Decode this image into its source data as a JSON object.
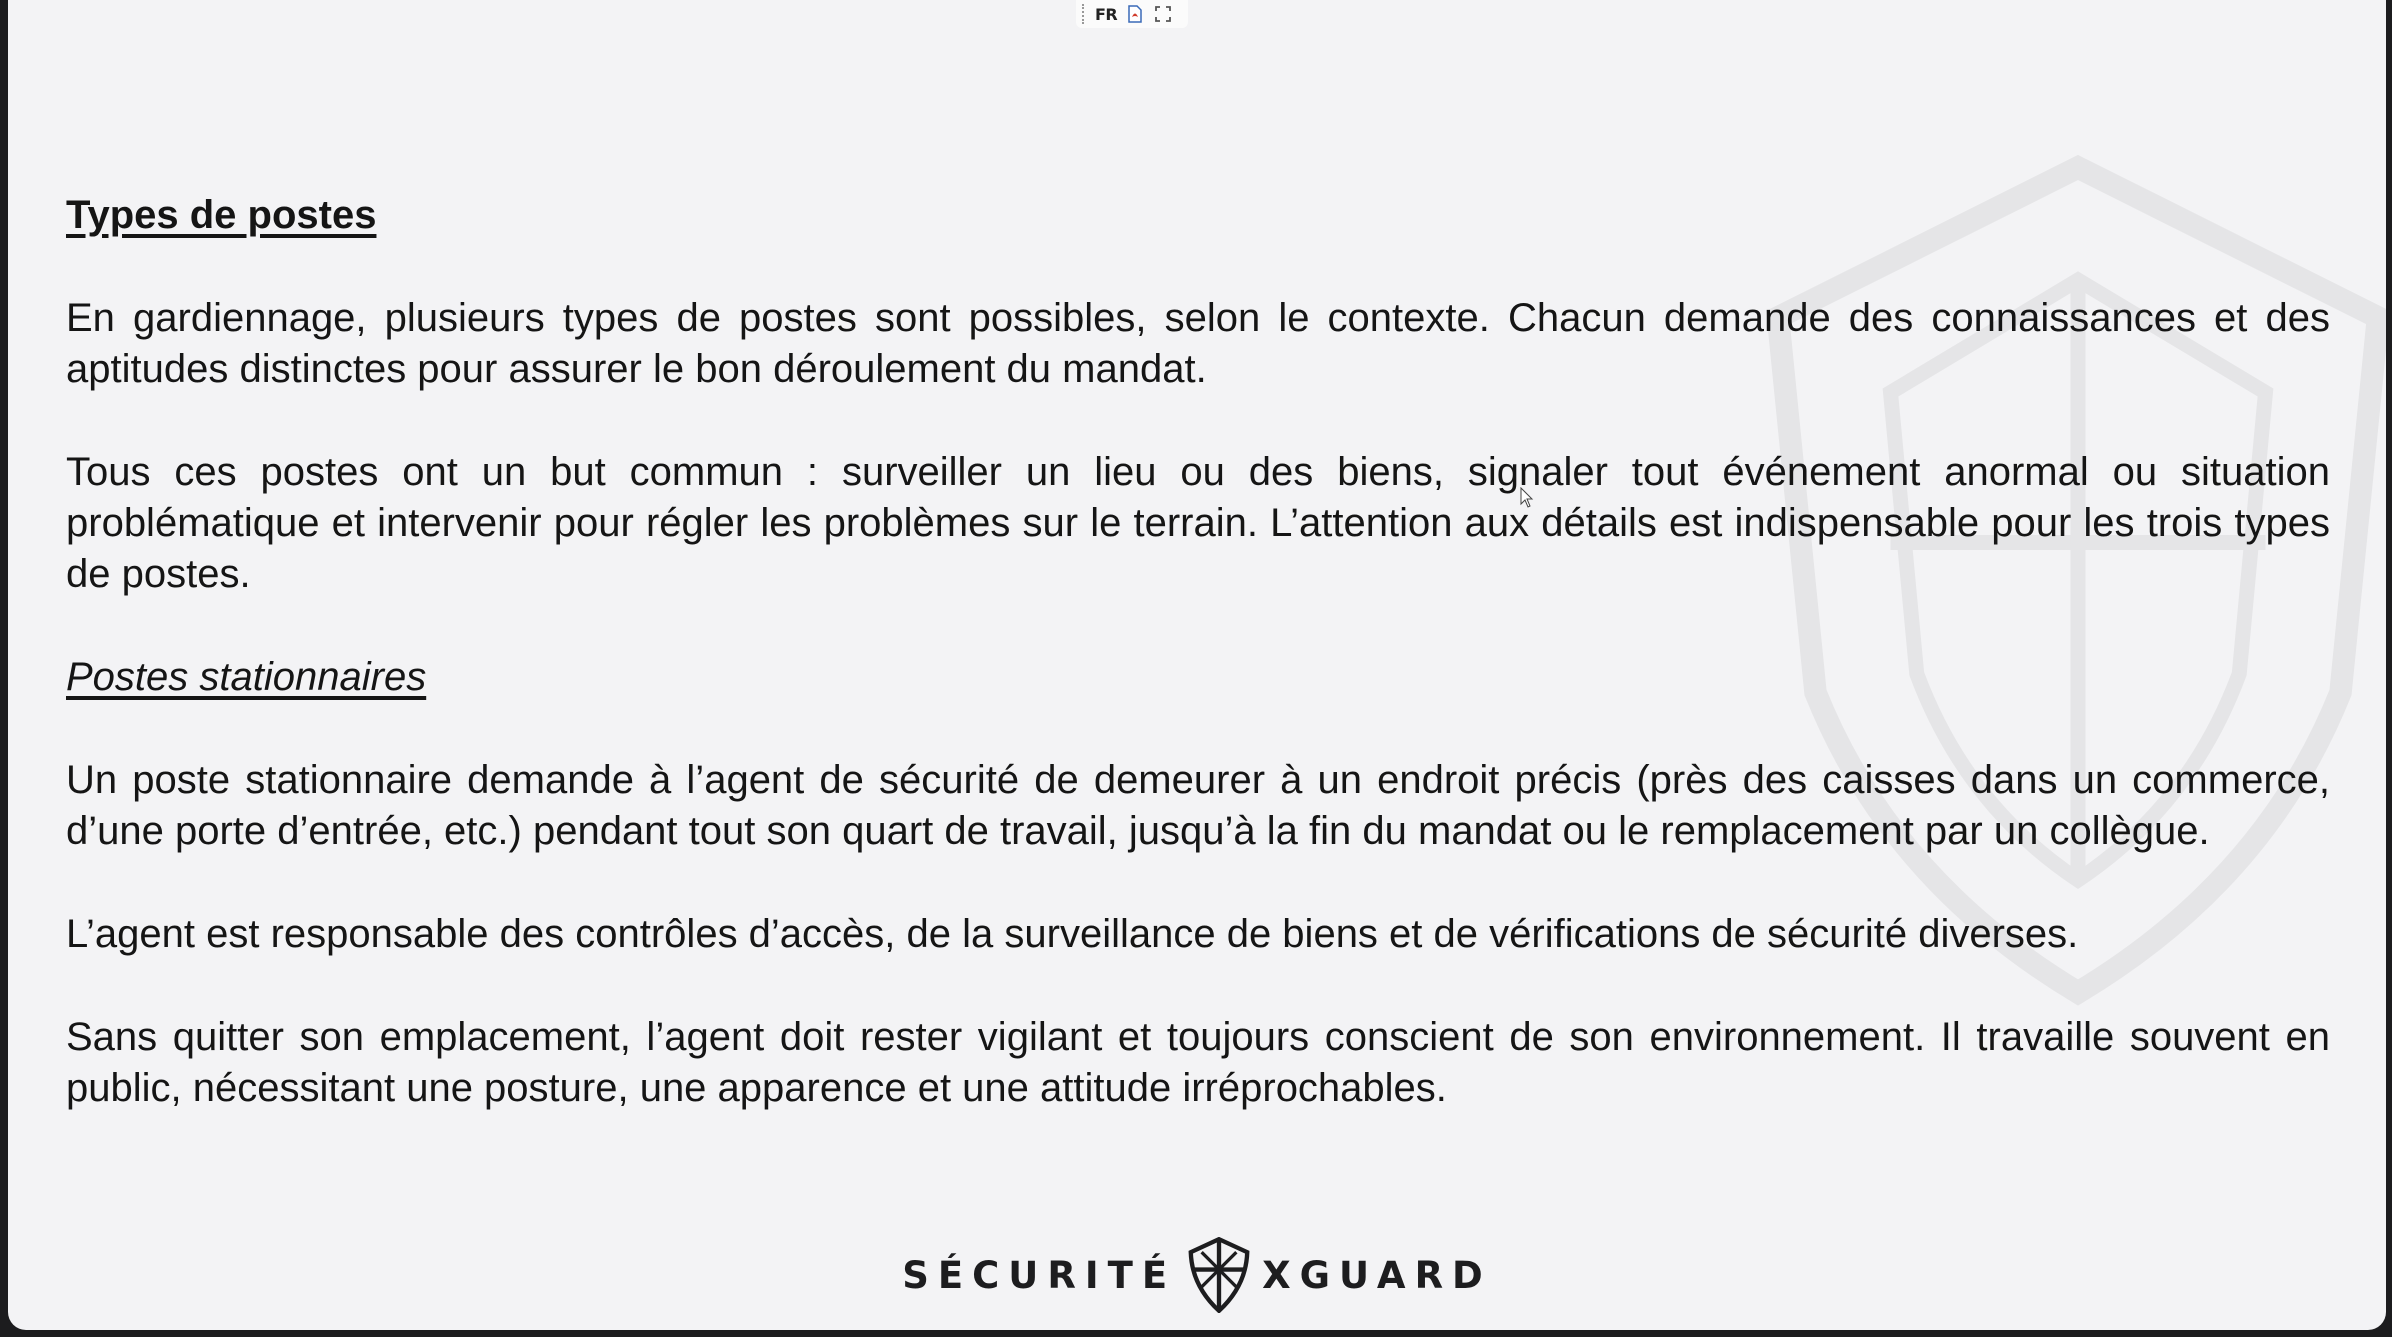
{
  "toolbar": {
    "language": "FR",
    "icons": [
      "pdf-icon",
      "expand-icon"
    ]
  },
  "document": {
    "title": "Types de postes",
    "paragraphs": [
      "En gardiennage, plusieurs types de postes sont possibles, selon le contexte. Chacun demande des connaissances et des aptitudes distinctes pour assurer le bon déroulement du mandat.",
      "Tous ces postes ont un but commun : surveiller un lieu ou des biens, signaler tout événement anormal ou situation problématique et intervenir pour régler les problèmes sur le terrain. L’attention aux détails est indispensable pour les trois types de postes."
    ],
    "subtitle": "Postes stationnaires",
    "section_paragraphs": [
      "Un poste stationnaire demande à l’agent de sécurité de demeurer à un endroit précis (près des caisses dans un commerce, d’une porte d’entrée, etc.) pendant tout son quart de travail, jusqu’à la fin du mandat ou le remplacement par un collègue.",
      "L’agent est responsable des contrôles d’accès, de la surveillance de biens et de vérifications de sécurité diverses.",
      "Sans quitter son emplacement, l’agent doit rester vigilant et toujours conscient de son environnement. Il travaille souvent en public, nécessitant une posture, une apparence et une attitude irréprochables."
    ]
  },
  "footer": {
    "brand_left": "SÉCURITÉ",
    "brand_right": "XGUARD",
    "logo_icon": "shield-logo-icon"
  },
  "colors": {
    "page_background": "#f3f3f5",
    "outer_frame": "#1c1c1e",
    "text": "#151515"
  }
}
